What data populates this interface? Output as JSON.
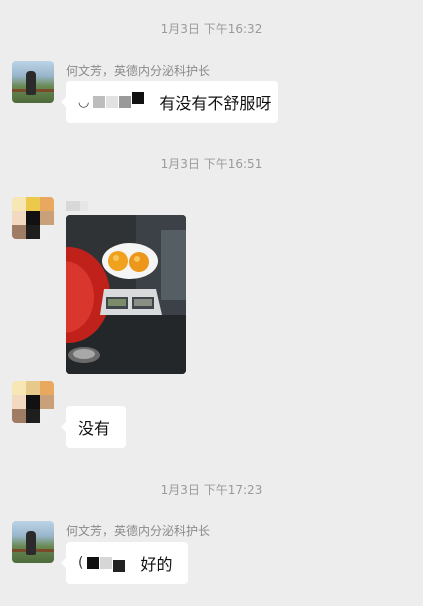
{
  "colors": {
    "background": "#ededed",
    "bubble": "#ffffff",
    "timestamp": "#9a9a9a",
    "sender_name": "#8a8a8a"
  },
  "timestamps": [
    "1月3日 下午16:32",
    "1月3日 下午16:51",
    "1月3日 下午17:23"
  ],
  "messages": [
    {
      "sender": "何文芳，英德内分泌科护长",
      "avatar_icon": "landscape-photo-avatar",
      "text": "有没有不舒服呀"
    },
    {
      "sender": "",
      "avatar_icon": "pixelated-avatar",
      "image_icon": "oranges-on-kitchen-scale-photo"
    },
    {
      "sender": "",
      "avatar_icon": "pixelated-avatar",
      "text": "没有"
    },
    {
      "sender": "何文芳，英德内分泌科护长",
      "avatar_icon": "landscape-photo-avatar",
      "text": "好的"
    }
  ]
}
